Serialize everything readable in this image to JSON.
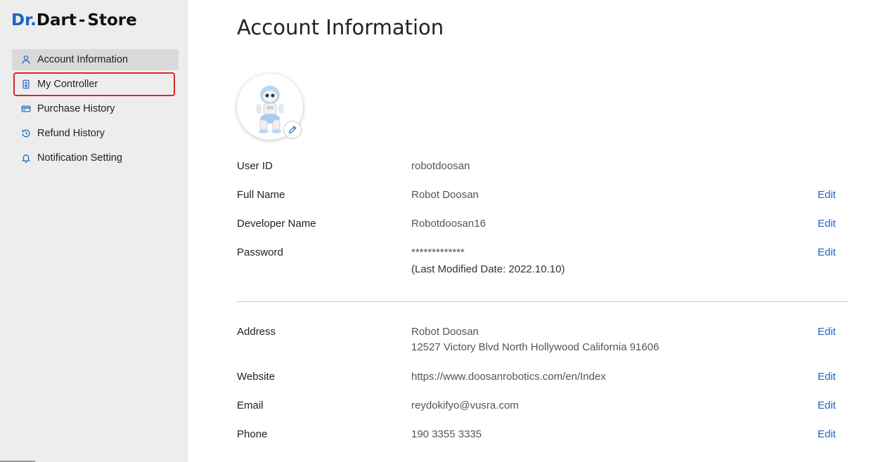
{
  "logo": {
    "dr": "Dr.",
    "dart": "Dart",
    "sep": "-",
    "store": "Store"
  },
  "sidebar": {
    "items": [
      {
        "label": "Account Information",
        "icon": "user-icon"
      },
      {
        "label": "My Controller",
        "icon": "controller-icon"
      },
      {
        "label": "Purchase History",
        "icon": "card-icon"
      },
      {
        "label": "Refund History",
        "icon": "refund-icon"
      },
      {
        "label": "Notification Setting",
        "icon": "bell-icon"
      }
    ]
  },
  "main": {
    "title": "Account Information",
    "edit_label": "Edit",
    "fields": {
      "user_id": {
        "label": "User ID",
        "value": "robotdoosan"
      },
      "full_name": {
        "label": "Full Name",
        "value": "Robot Doosan"
      },
      "developer_name": {
        "label": "Developer Name",
        "value": "Robotdoosan16"
      },
      "password": {
        "label": "Password",
        "value": "*************",
        "note": "(Last Modified Date: 2022.10.10)"
      },
      "address": {
        "label": "Address",
        "line1": "Robot Doosan",
        "line2": "12527 Victory Blvd North Hollywood California 91606"
      },
      "website": {
        "label": "Website",
        "value": "https://www.doosanrobotics.com/en/Index"
      },
      "email": {
        "label": "Email",
        "value": "reydokifyo@vusra.com"
      },
      "phone": {
        "label": "Phone",
        "value": "190 3355 3335"
      }
    }
  },
  "colors": {
    "accent": "#1e63c4",
    "sidebar_bg": "#ededed",
    "active_bg": "#d9d9d9",
    "focus_outline": "#d42a2a"
  }
}
